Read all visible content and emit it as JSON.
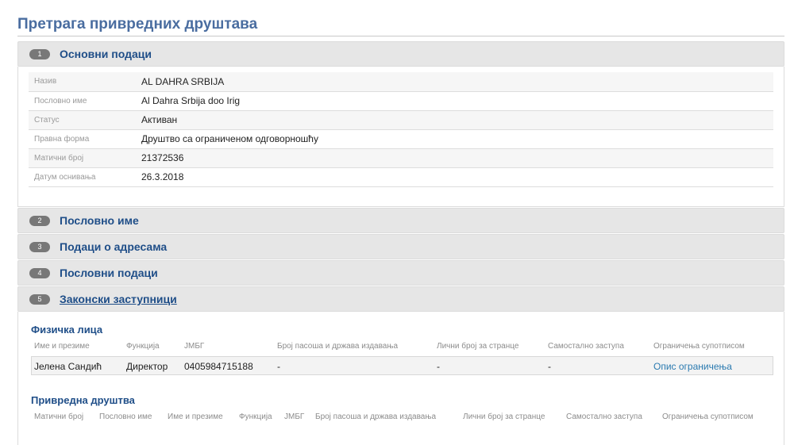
{
  "page_title": "Претрага привредних друштава",
  "sections": [
    {
      "num": "1",
      "title": "Основни подаци"
    },
    {
      "num": "2",
      "title": "Пословно име"
    },
    {
      "num": "3",
      "title": "Подаци о адресама"
    },
    {
      "num": "4",
      "title": "Пословни подаци"
    },
    {
      "num": "5",
      "title": "Законски заступници"
    }
  ],
  "basic_info": [
    {
      "label": "Назив",
      "value": "AL DAHRA SRBIJA"
    },
    {
      "label": "Пословно име",
      "value": "Al Dahra Srbija doo Irig"
    },
    {
      "label": "Статус",
      "value": "Активан"
    },
    {
      "label": "Правна форма",
      "value": "Друштво са ограниченом одговорношћу"
    },
    {
      "label": "Матични број",
      "value": "21372536"
    },
    {
      "label": "Датум оснивања",
      "value": "26.3.2018"
    }
  ],
  "natural_persons": {
    "title": "Физичка лица",
    "columns": [
      "Име и презиме",
      "Функција",
      "ЈМБГ",
      "Број пасоша и држава издавања",
      "Лични број за странце",
      "Самостално заступа",
      "Ограничења супотписом"
    ],
    "row": {
      "name": "Јелена Сандић",
      "function": "Директор",
      "jmbg": "0405984715188",
      "passport": "-",
      "foreign_id": "-",
      "independent": "-",
      "restriction_link": "Опис ограничења"
    }
  },
  "companies": {
    "title": "Привредна друштва",
    "columns": [
      "Матични број",
      "Пословно име",
      "Име и презиме",
      "Функција",
      "ЈМБГ",
      "Број пасоша и држава издавања",
      "Лични број за странце",
      "Самостално заступа",
      "Ограничења супотписом"
    ]
  }
}
